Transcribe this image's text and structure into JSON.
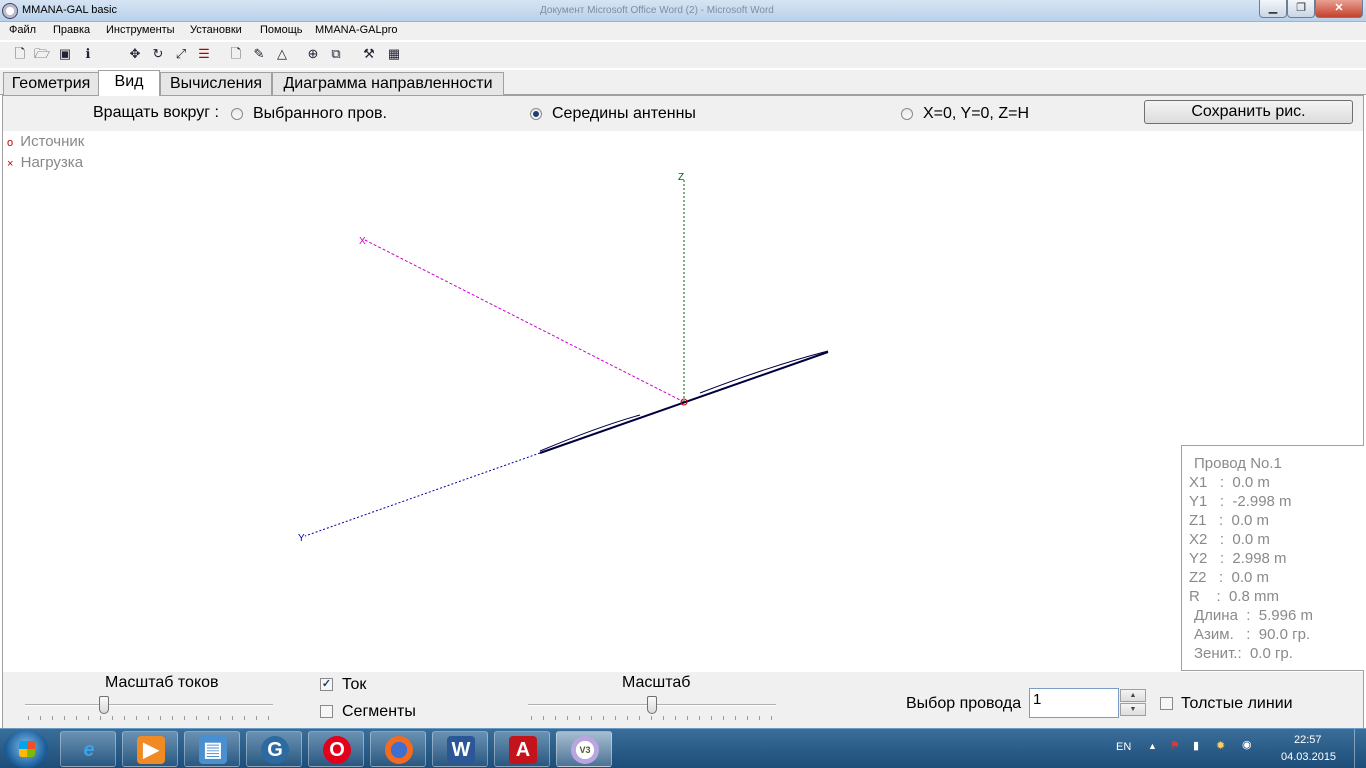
{
  "window": {
    "title": "MMANA-GAL basic",
    "ghost_title": "Документ Microsoft Office Word (2) - Microsoft Word",
    "min_glyph": "▁",
    "max_glyph": "❐",
    "close_glyph": "✕"
  },
  "menu": [
    "Файл",
    "Правка",
    "Инструменты",
    "Установки",
    "Помощь",
    "MMANA-GALpro"
  ],
  "toolbar_icons": [
    "new-file-icon",
    "open-file-icon",
    "save-icon",
    "info-icon",
    "move-icon",
    "rotate-icon",
    "resize-icon",
    "align-icon",
    "page-icon",
    "edit-icon",
    "triangle-icon",
    "target-icon",
    "copy-icon",
    "tools-icon",
    "calculator-icon"
  ],
  "tabs": [
    {
      "label": "Геометрия",
      "active": false
    },
    {
      "label": "Вид",
      "active": true
    },
    {
      "label": "Вычисления",
      "active": false
    },
    {
      "label": "Диаграмма направленности",
      "active": false
    }
  ],
  "rotate": {
    "label": "Вращать вокруг :",
    "options": [
      {
        "label": "Выбранного пров.",
        "selected": false
      },
      {
        "label": "Середины антенны",
        "selected": true
      },
      {
        "label": "X=0, Y=0, Z=H",
        "selected": false
      }
    ],
    "save_button": "Сохранить рис."
  },
  "legend": [
    {
      "symbol": "o",
      "label": "Источник",
      "color": "#c00000"
    },
    {
      "symbol": "×",
      "label": "Нагрузка",
      "color": "#c00000"
    }
  ],
  "axes": {
    "x_label": "X",
    "y_label": "Y",
    "z_label": "Z",
    "x_color": "#cc00cc",
    "y_color": "#0000aa",
    "z_color": "#006600",
    "wire_color": "#000040"
  },
  "info": {
    "title": "Провод No.1",
    "rows": [
      "X1   :  0.0 m",
      "Y1   :  -2.998 m",
      "Z1   :  0.0 m",
      "X2   :  0.0 m",
      "Y2   :  2.998 m",
      "Z2   :  0.0 m",
      "R    :  0.8 mm",
      "Длина  :  5.996 m",
      "Азим.   :  90.0 гр.",
      "Зенит.:  0.0 гр."
    ]
  },
  "bottom": {
    "current_scale_label": "Масштаб токов",
    "current_scale_value": 0.32,
    "current_checkbox": {
      "label": "Ток",
      "checked": true
    },
    "segments_checkbox": {
      "label": "Сегменты",
      "checked": false
    },
    "scale_label": "Масштаб",
    "scale_value": 0.5,
    "wire_select_label": "Выбор провода",
    "wire_select_value": "1",
    "thick_lines": {
      "label": "Толстые линии",
      "checked": false
    }
  },
  "taskbar": {
    "apps": [
      "internet-explorer-icon",
      "media-player-icon",
      "files-icon",
      "network-app-icon",
      "opera-icon",
      "firefox-icon",
      "word-icon",
      "acrobat-icon",
      "mmana-icon"
    ],
    "lang": "EN",
    "time": "22:57",
    "date": "04.03.2015"
  }
}
